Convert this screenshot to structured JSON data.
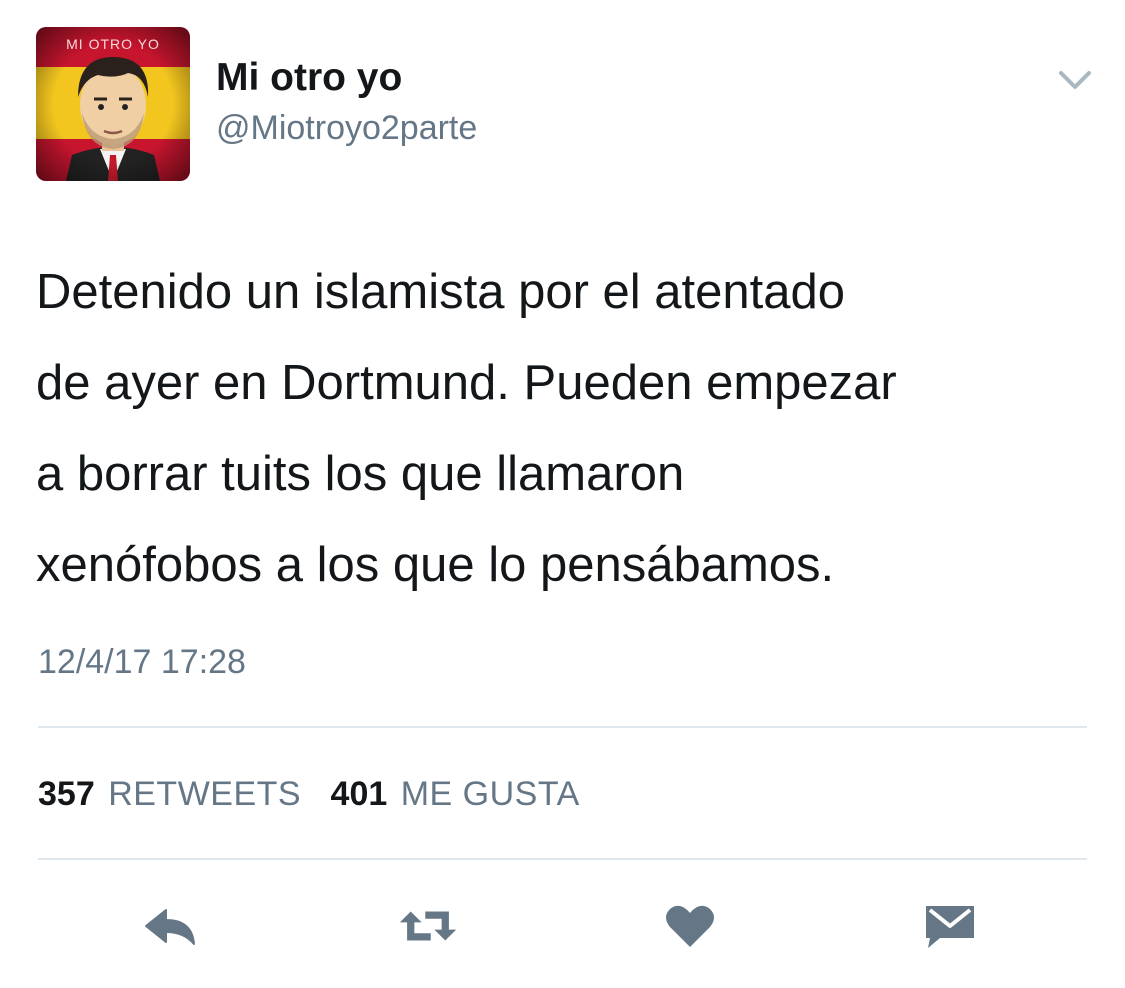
{
  "colors": {
    "text_primary": "#14171a",
    "text_secondary": "#657786",
    "icon_gray": "#657786",
    "divider": "#e1e8ed"
  },
  "author": {
    "name": "Mi otro yo",
    "handle": "@Miotroyo2parte",
    "avatar_caption": "MI OTRO YO"
  },
  "tweet": {
    "text": "Detenido un islamista por el atentado\nde ayer en Dortmund. Pueden empezar\na borrar tuits los que llamaron\nxenófobos a los que lo pensábamos.",
    "timestamp": "12/4/17 17:28"
  },
  "stats": {
    "retweets_count": "357",
    "retweets_label": "RETWEETS",
    "likes_count": "401",
    "likes_label": "ME GUSTA"
  },
  "actions": {
    "icons": [
      "reply-icon",
      "retweet-icon",
      "heart-icon",
      "envelope-icon"
    ]
  },
  "menu": {
    "icon": "chevron-down-icon"
  }
}
